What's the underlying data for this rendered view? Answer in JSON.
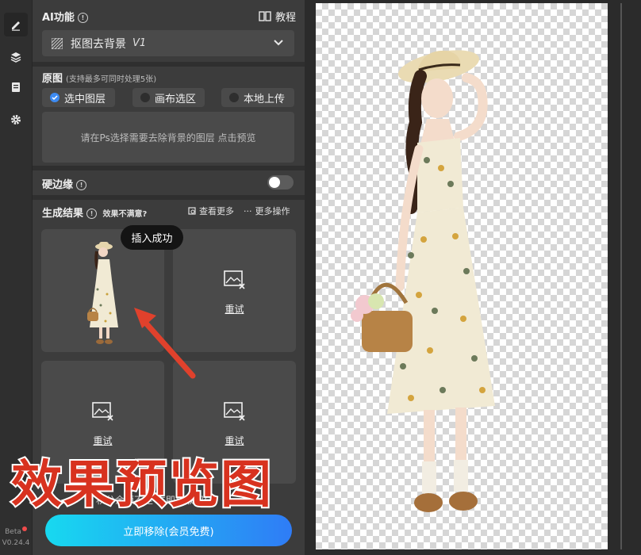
{
  "rail": {
    "icons": [
      "edit-icon",
      "layers-icon",
      "clipboard-icon",
      "gear-icon"
    ],
    "beta": "Beta",
    "version": "V0.24.4"
  },
  "panel": {
    "ai_title": "AI功能",
    "tutorial": "教程",
    "feature_select": {
      "label": "抠图去背景",
      "tag": "V1"
    },
    "source": {
      "title": "原图",
      "hint": "(支持最多可同时处理5张)",
      "options": [
        {
          "label": "选中图层",
          "selected": true
        },
        {
          "label": "画布选区",
          "selected": false
        },
        {
          "label": "本地上传",
          "selected": false
        }
      ],
      "dropzone_text": "请在Ps选择需要去除背景的图层 点击预览"
    },
    "hard_edge": {
      "label": "硬边缘",
      "on": false
    },
    "results": {
      "title": "生成结果",
      "unsatisfied": "效果不满意?",
      "view_more": "查看更多",
      "more_actions": "更多操作",
      "retry": "重试",
      "tooltip": "插入成功"
    },
    "bottom_note": "积分余额不足  立即获取积分",
    "cta": "立即移除(会员免费)"
  },
  "overlay_text": "效果预览图",
  "colors": {
    "accent": "#3d8bf2",
    "cta_start": "#17d9f0",
    "cta_end": "#2f7cf6",
    "overlay": "#d8321f"
  }
}
